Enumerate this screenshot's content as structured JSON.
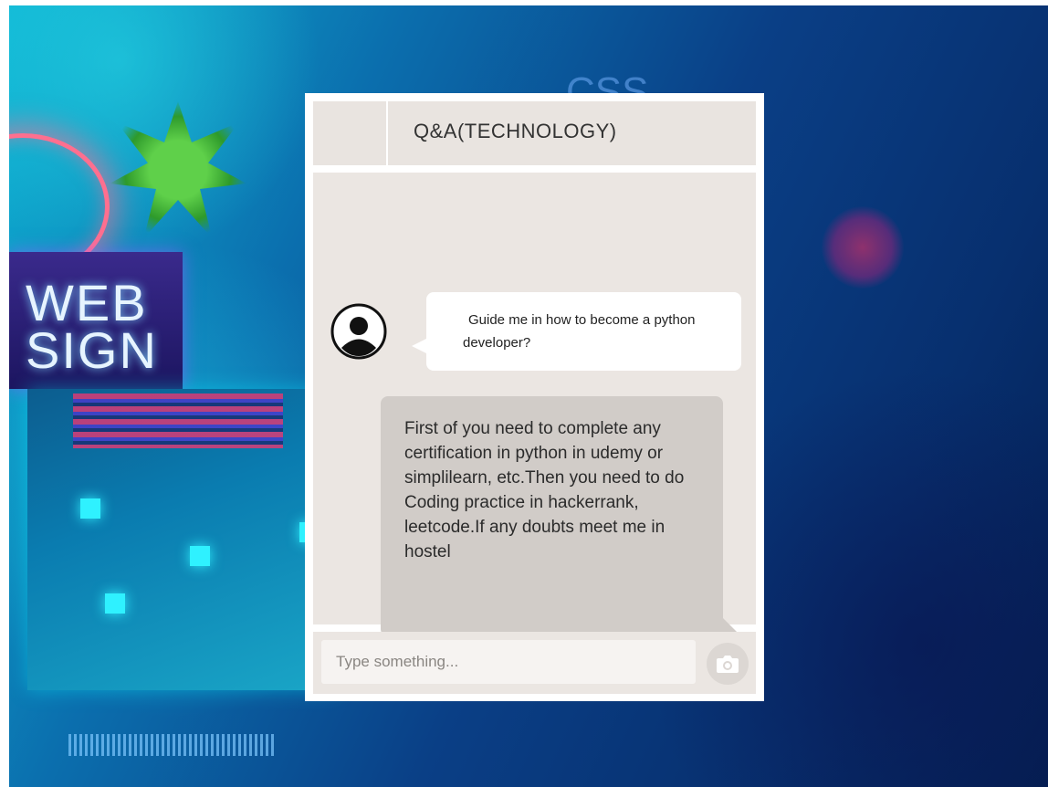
{
  "chat": {
    "title": "Q&A(TECHNOLOGY)",
    "messages": [
      {
        "from": "user",
        "text": "Guide me in how to become a python developer?"
      },
      {
        "from": "reply",
        "text": "First of you need to complete any certification in python in udemy or simplilearn, etc.Then you need to do Coding practice in hackerrank, leetcode.If any doubts meet me in hostel"
      }
    ],
    "input": {
      "placeholder": "Type something...",
      "value": ""
    },
    "send_icon": "camera-icon"
  },
  "background": {
    "decor_text_web": "WEB\nSIGN",
    "decor_text_css": "CSS"
  },
  "colors": {
    "header_bg": "#e9e4e0",
    "body_bg": "#ebe6e2",
    "incoming_bubble": "#ffffff",
    "outgoing_bubble": "#d1ccc8"
  }
}
